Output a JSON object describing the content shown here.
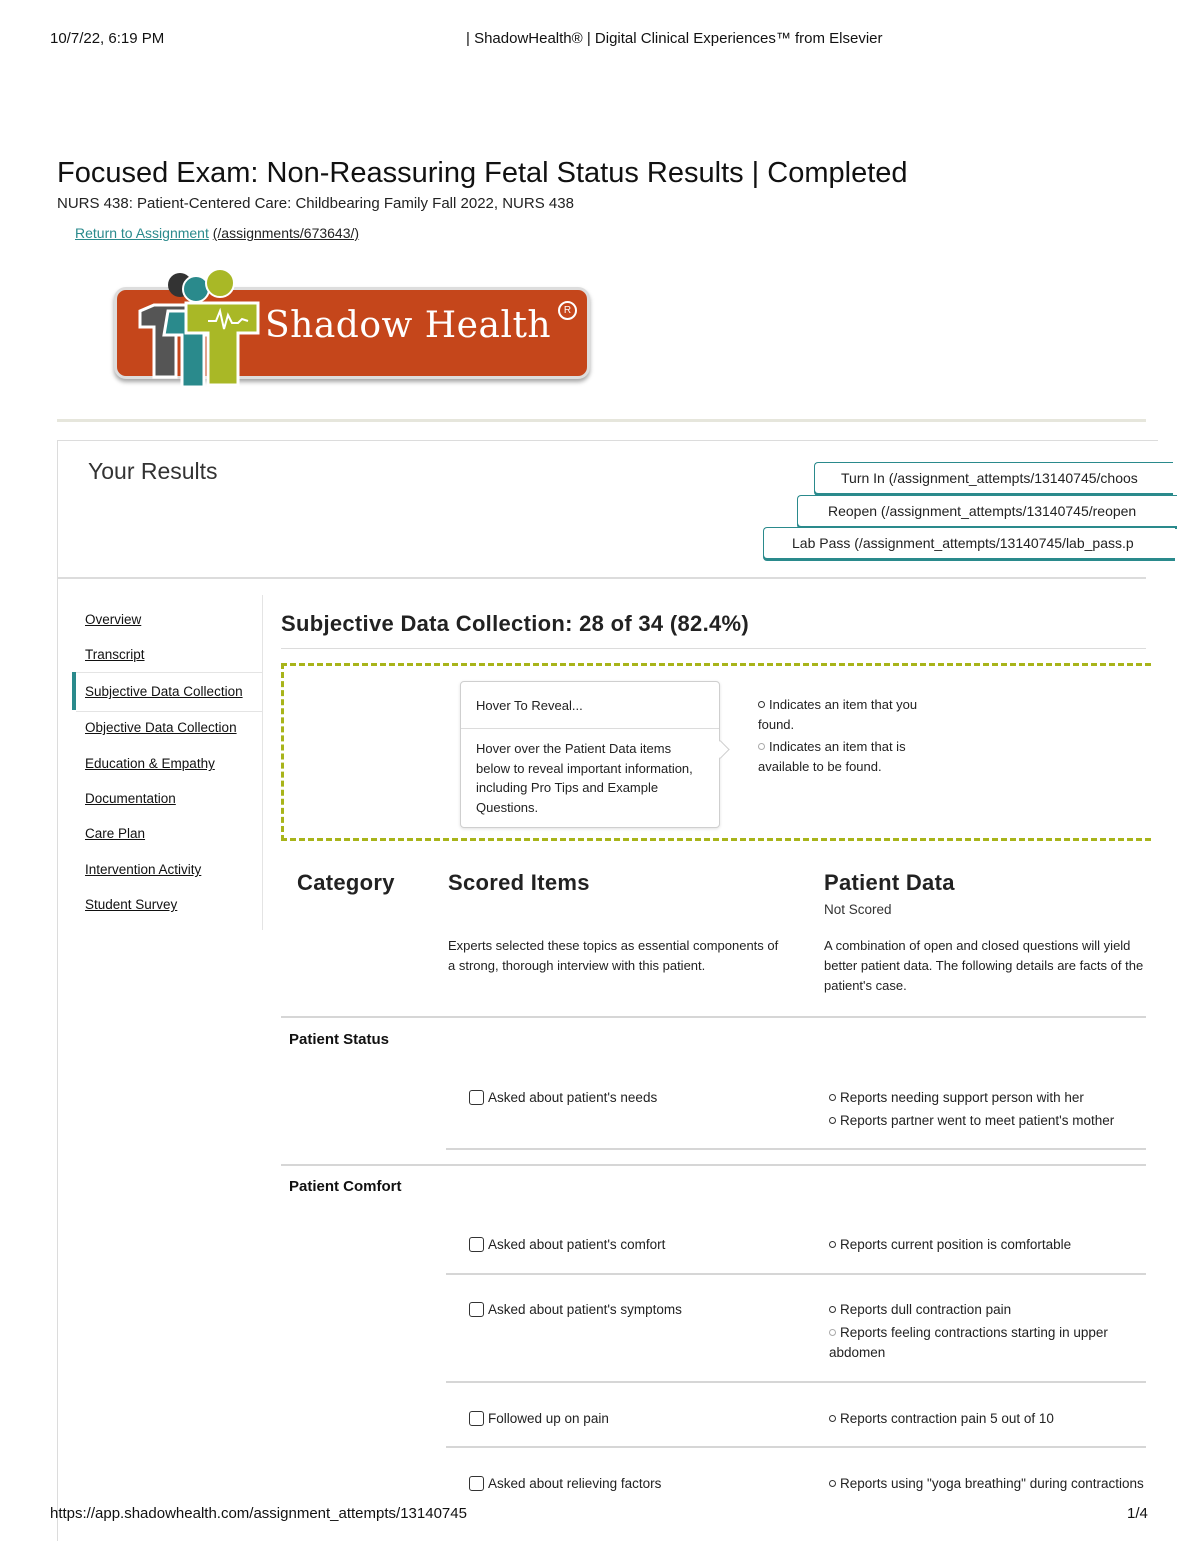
{
  "print_header": {
    "datetime": "10/7/22, 6:19 PM",
    "title": "| ShadowHealth® | Digital Clinical Experiences™ from Elsevier"
  },
  "page": {
    "title": "Focused Exam: Non-Reassuring Fetal Status Results | Completed",
    "course": "NURS 438: Patient-Centered Care: Childbearing Family Fall 2022, NURS 438",
    "return_link_label": "Return to Assignment",
    "return_link_path": "(/assignments/673643/)"
  },
  "logo": {
    "text": "Shadow Health",
    "registered": "R"
  },
  "results": {
    "heading": "Your Results",
    "buttons": {
      "turn_in": "Turn In (/assignment_attempts/13140745/choos",
      "reopen": "Reopen (/assignment_attempts/13140745/reopen",
      "lab_pass": "Lab Pass (/assignment_attempts/13140745/lab_pass.p"
    }
  },
  "sidebar": {
    "items": [
      {
        "label": "Overview"
      },
      {
        "label": "Transcript"
      },
      {
        "label": "Subjective Data Collection",
        "active": true
      },
      {
        "label": "Objective Data Collection"
      },
      {
        "label": "Education & Empathy"
      },
      {
        "label": "Documentation"
      },
      {
        "label": "Care Plan"
      },
      {
        "label": "Intervention Activity"
      },
      {
        "label": "Student Survey"
      }
    ]
  },
  "section": {
    "title": "Subjective Data Collection: 28 of 34 (82.4%)"
  },
  "legend": {
    "hover_title": "Hover To Reveal...",
    "hover_body": "Hover over the Patient Data items below to reveal important information, including Pro Tips and Example Questions.",
    "found": "Indicates an item that you found.",
    "available": "Indicates an item that is available to be found."
  },
  "columns": {
    "category": "Category",
    "scored_items": "Scored Items",
    "patient_data": "Patient Data",
    "not_scored": "Not Scored",
    "scored_desc": "Experts selected these topics as essential components of a strong, thorough interview with this patient.",
    "patient_desc": "A combination of open and closed questions will yield better patient data. The following details are facts of the patient's case."
  },
  "categories": [
    {
      "name": "Patient Status",
      "items": [
        {
          "label": "Asked about patient's needs",
          "data": [
            "Reports needing support person with her",
            "Reports partner went to meet patient's mother"
          ]
        }
      ]
    },
    {
      "name": "Patient Comfort",
      "items": [
        {
          "label": "Asked about patient's comfort",
          "data": [
            "Reports current position is comfortable"
          ]
        },
        {
          "label": "Asked about patient's symptoms",
          "data": [
            "Reports dull contraction pain",
            "Reports feeling contractions starting in upper abdomen"
          ]
        },
        {
          "label": "Followed up on pain",
          "data": [
            "Reports contraction pain 5 out of 10"
          ]
        },
        {
          "label": "Asked about relieving factors",
          "data": [
            "Reports using \"yoga breathing\" during contractions"
          ]
        }
      ]
    }
  ],
  "footer": {
    "url": "https://app.shadowhealth.com/assignment_attempts/13140745",
    "page": "1/4"
  },
  "colors": {
    "accent": "#2a8a8c",
    "dashed_border": "#a8b41a",
    "logo_bg": "#c5461b",
    "logo_figure_green": "#a9b826",
    "logo_figure_teal": "#2a8a8c"
  }
}
